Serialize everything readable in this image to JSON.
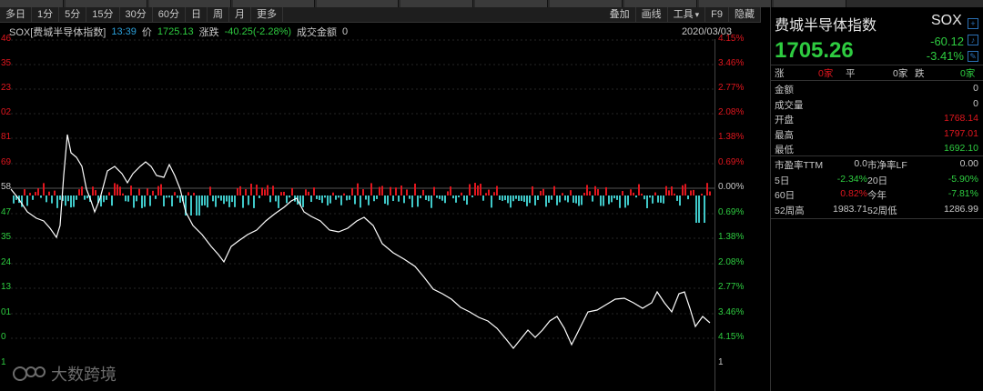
{
  "toolbar": {
    "periods": [
      "多日",
      "1分",
      "5分",
      "15分",
      "30分",
      "60分",
      "日",
      "周",
      "月",
      "更多"
    ],
    "right": [
      "叠加",
      "画线",
      "工具",
      "F9",
      "隐藏"
    ]
  },
  "info": {
    "name": "SOX[费城半导体指数]",
    "time": "13:39",
    "price_label": "价",
    "price": "1725.13",
    "chg_label": "涨跌",
    "chg": "-40.25(-2.28%)",
    "amount_label": "成交金额",
    "amount": "0",
    "date": "2020/03/03"
  },
  "left_axis": [
    "46",
    "35",
    "23",
    "02",
    "81",
    "69",
    "58",
    "47",
    "35",
    "24",
    "13",
    "01",
    "0",
    "1"
  ],
  "right_axis": [
    {
      "t": "4.15%",
      "c": "red"
    },
    {
      "t": "3.46%",
      "c": "red"
    },
    {
      "t": "2.77%",
      "c": "red"
    },
    {
      "t": "2.08%",
      "c": "red"
    },
    {
      "t": "1.38%",
      "c": "red"
    },
    {
      "t": "0.69%",
      "c": "red"
    },
    {
      "t": "0.00%",
      "c": "wht"
    },
    {
      "t": "0.69%",
      "c": "grn"
    },
    {
      "t": "1.38%",
      "c": "grn"
    },
    {
      "t": "2.08%",
      "c": "grn"
    },
    {
      "t": "2.77%",
      "c": "grn"
    },
    {
      "t": "3.46%",
      "c": "grn"
    },
    {
      "t": "4.15%",
      "c": "grn"
    },
    {
      "t": "1",
      "c": "wht"
    }
  ],
  "watermark": "大数跨境",
  "panel": {
    "name": "费城半导体指数",
    "code": "SOX",
    "price": "1705.26",
    "change": "-60.12",
    "change_pct": "-3.41%",
    "ud": {
      "up_label": "涨",
      "up": "0家",
      "flat_label": "平",
      "flat": "0家",
      "down_label": "跌",
      "down": "0家"
    },
    "rows1": [
      {
        "k": "金额",
        "v": "0",
        "c": "wht"
      },
      {
        "k": "成交量",
        "v": "0",
        "c": "wht"
      },
      {
        "k": "开盘",
        "v": "1768.14",
        "c": "red"
      },
      {
        "k": "最高",
        "v": "1797.01",
        "c": "red"
      },
      {
        "k": "最低",
        "v": "1692.10",
        "c": "grn"
      }
    ],
    "grid": [
      [
        {
          "t": "市盈率TTM",
          "c": "wht"
        },
        {
          "t": "0.0",
          "c": "wht"
        },
        {
          "t": "市净率LF",
          "c": "wht"
        },
        {
          "t": "0.00",
          "c": "wht"
        }
      ],
      [
        {
          "t": "5日",
          "c": "wht"
        },
        {
          "t": "-2.34%",
          "c": "grn"
        },
        {
          "t": "20日",
          "c": "wht"
        },
        {
          "t": "-5.90%",
          "c": "grn"
        }
      ],
      [
        {
          "t": "60日",
          "c": "wht"
        },
        {
          "t": "0.82%",
          "c": "red"
        },
        {
          "t": "今年",
          "c": "wht"
        },
        {
          "t": "-7.81%",
          "c": "grn"
        }
      ],
      [
        {
          "t": "52周高",
          "c": "wht"
        },
        {
          "t": "1983.71",
          "c": "wht"
        },
        {
          "t": "52周低",
          "c": "wht"
        },
        {
          "t": "1286.99",
          "c": "wht"
        }
      ]
    ]
  },
  "colors": {
    "up": "#e0161e",
    "down": "#2ecc40",
    "bar_down": "#3fc8c8",
    "line": "#ffffff"
  }
}
